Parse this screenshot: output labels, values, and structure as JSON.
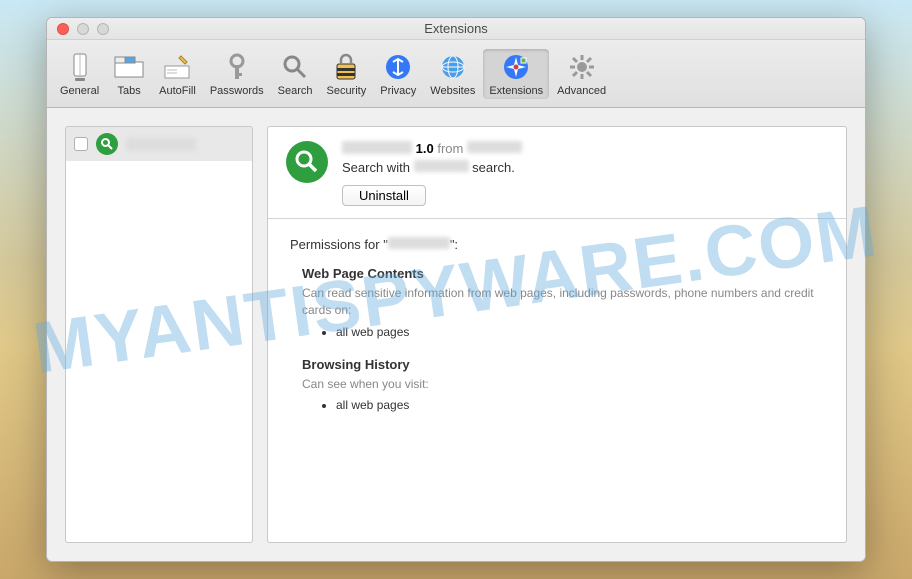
{
  "window": {
    "title": "Extensions"
  },
  "toolbar": {
    "items": [
      {
        "label": "General"
      },
      {
        "label": "Tabs"
      },
      {
        "label": "AutoFill"
      },
      {
        "label": "Passwords"
      },
      {
        "label": "Search"
      },
      {
        "label": "Security"
      },
      {
        "label": "Privacy"
      },
      {
        "label": "Websites"
      },
      {
        "label": "Extensions"
      },
      {
        "label": "Advanced"
      }
    ]
  },
  "sidebar": {
    "items": [
      {
        "name_redacted": "████████",
        "checked": false
      }
    ]
  },
  "detail": {
    "name_redacted": "████████",
    "version": "1.0",
    "from_label": "from",
    "author_redacted": "████████",
    "desc_prefix": "Search with",
    "desc_mid_redacted": "████████",
    "desc_suffix": "search.",
    "uninstall_label": "Uninstall"
  },
  "permissions": {
    "header_prefix": "Permissions for \"",
    "header_name_redacted": "████████",
    "header_suffix": "\":",
    "sections": [
      {
        "title": "Web Page Contents",
        "desc": "Can read sensitive information from web pages, including passwords, phone numbers and credit cards on:",
        "items": [
          "all web pages"
        ]
      },
      {
        "title": "Browsing History",
        "desc": "Can see when you visit:",
        "items": [
          "all web pages"
        ]
      }
    ]
  },
  "watermark": "MYANTISPYWARE.COM"
}
